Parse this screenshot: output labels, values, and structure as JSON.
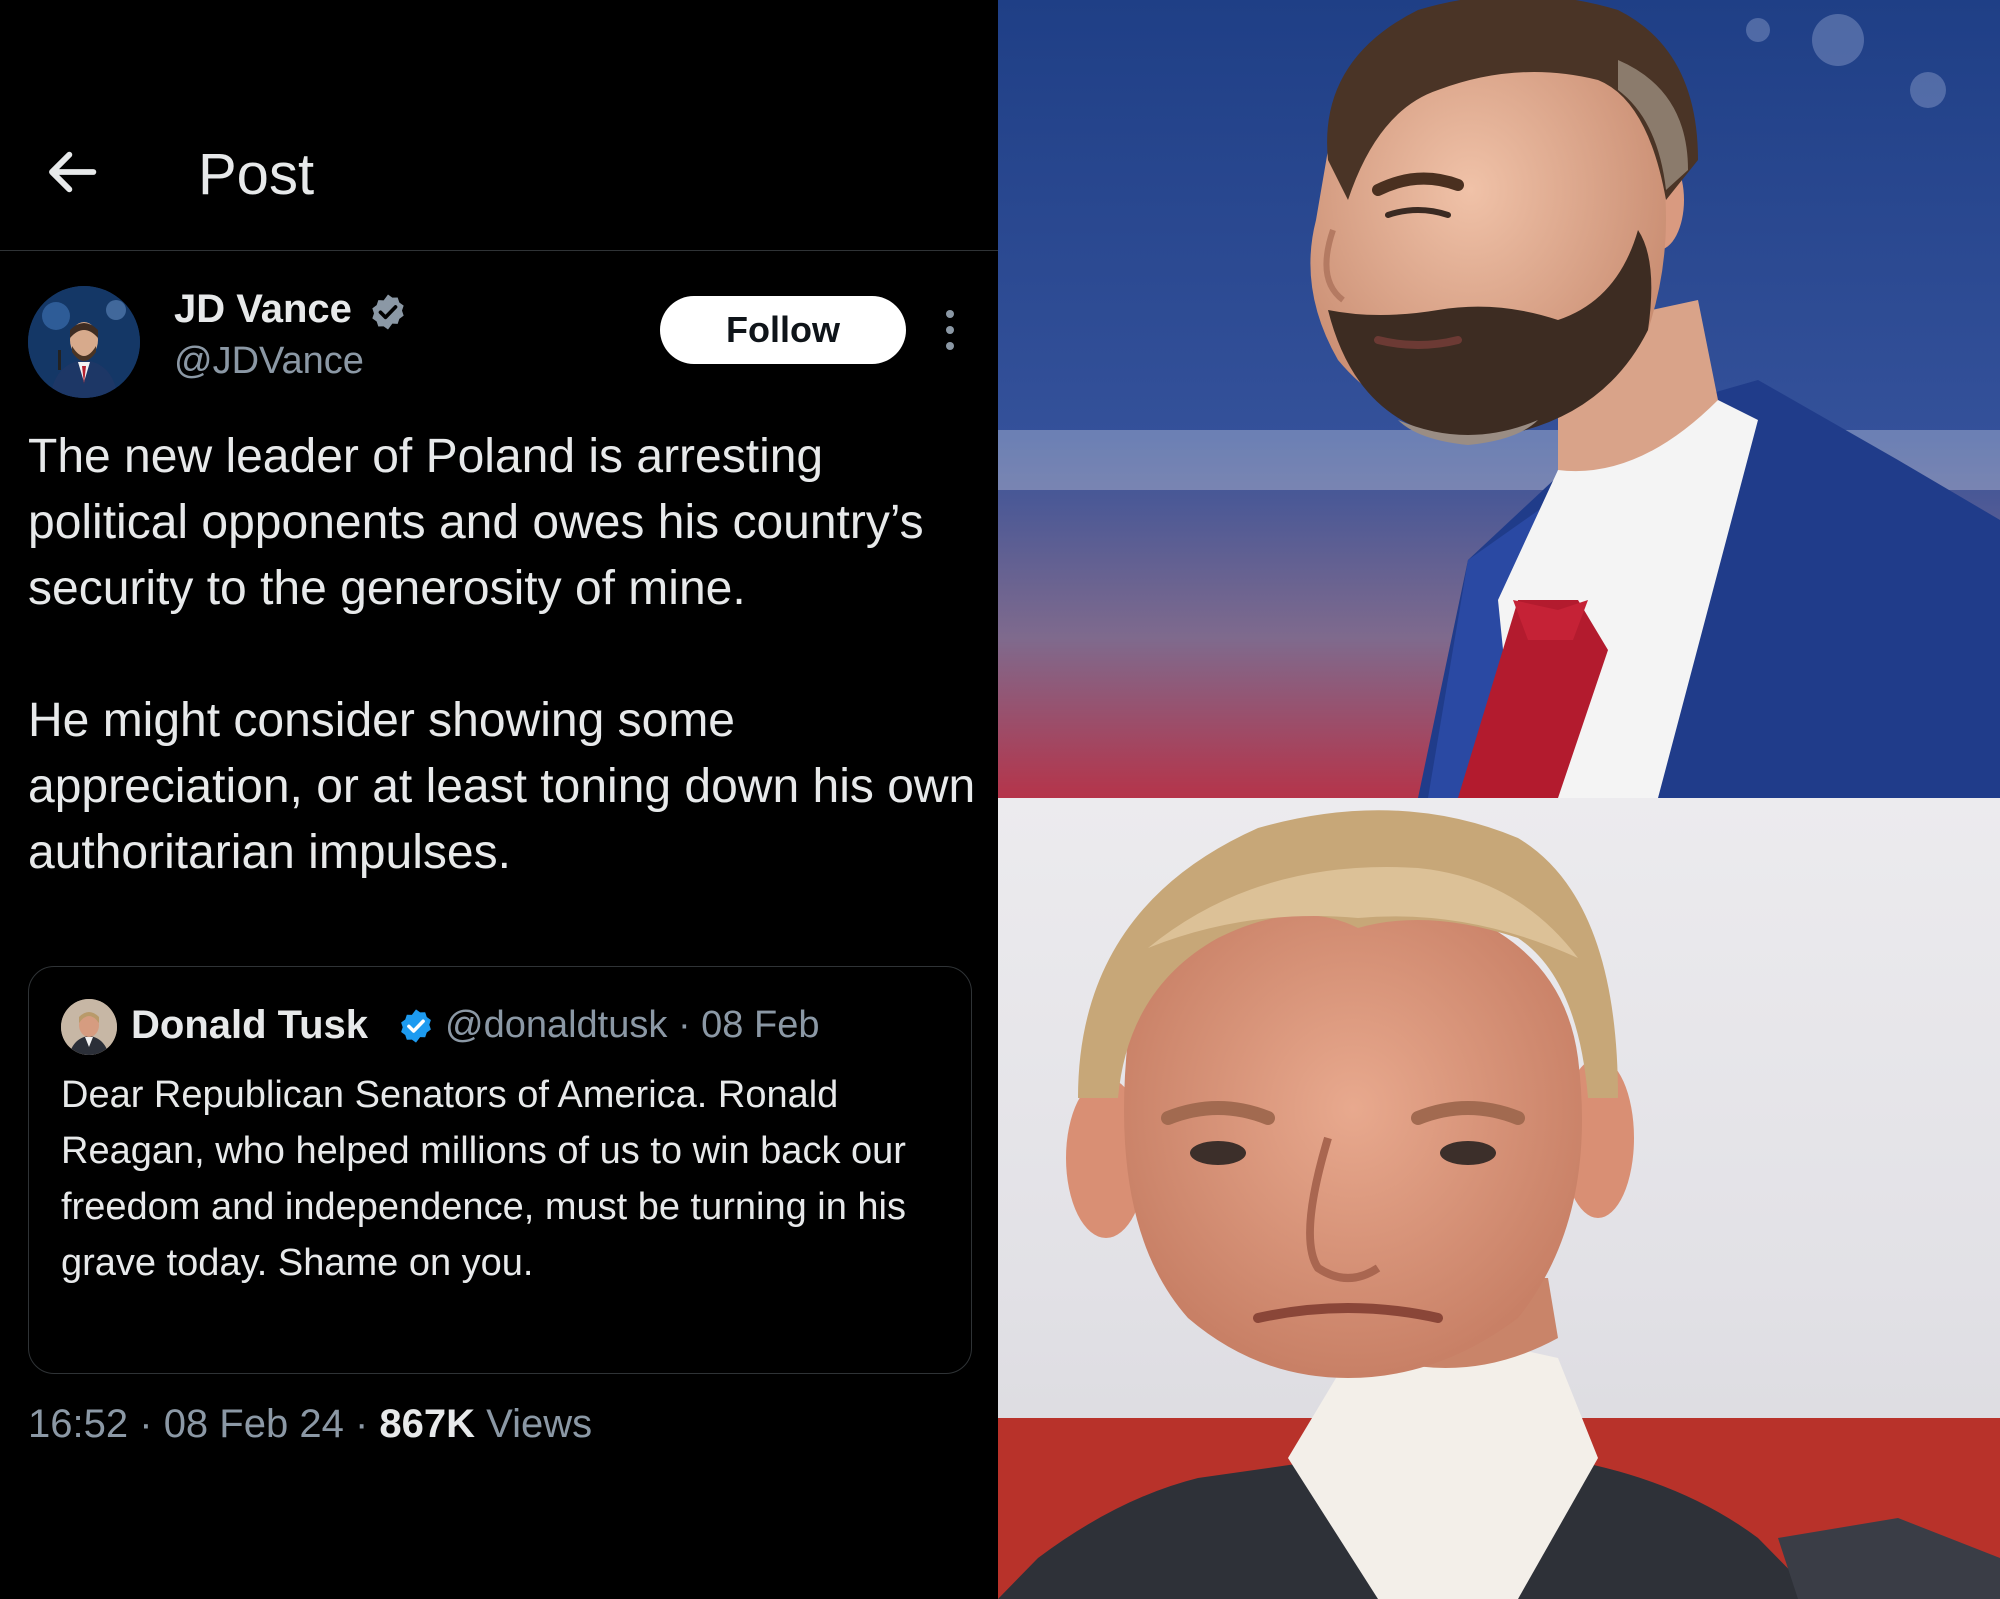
{
  "header": {
    "back_icon": "arrow-left-icon",
    "title": "Post"
  },
  "post": {
    "author": {
      "name": "JD Vance",
      "handle": "@JDVance",
      "verified": true,
      "verified_color": "#8b98a5"
    },
    "follow_label": "Follow",
    "more_icon": "more-vertical-icon",
    "paragraphs": [
      "The new leader of Poland is arresting political opponents and owes his country’s security to the generosity of mine.",
      "He might consider showing some appreciation, or at least toning down his own authoritarian impulses."
    ],
    "quote": {
      "name": "Donald Tusk",
      "verified": true,
      "verified_color": "#1d9bf0",
      "handle": "@donaldtusk",
      "date": "08 Feb",
      "separator": "·",
      "text": "Dear Republican Senators of America. Ronald Reagan, who helped millions of us to win back our freedom and independence, must be turning in his grave today. Shame on you."
    },
    "meta": {
      "time": "16:52",
      "date": "08 Feb 24",
      "separator": "·",
      "views_count": "867K",
      "views_label": "Views"
    }
  },
  "colors": {
    "background": "#000000",
    "text": "#e7e9ea",
    "secondary_text": "#8b98a5",
    "border": "#2f3336",
    "verified_blue": "#1d9bf0"
  }
}
